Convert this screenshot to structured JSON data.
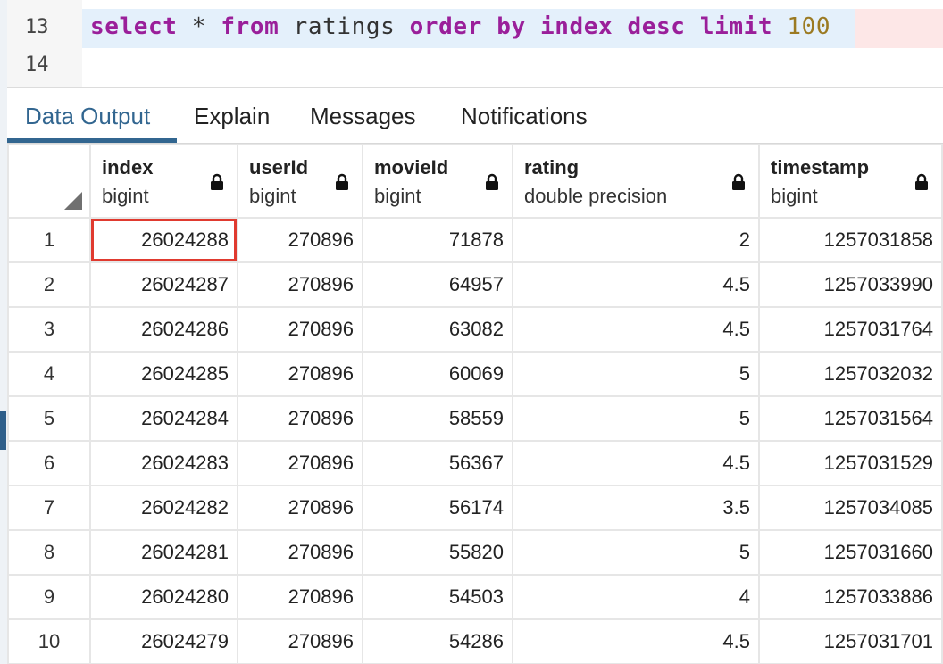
{
  "editor": {
    "lines": [
      {
        "number": "13",
        "tokens": {
          "k1": "select",
          "op": "*",
          "k2": "from",
          "t1": "ratings",
          "k3": "order",
          "k4": "by",
          "k5": "index",
          "k6": "desc",
          "k7": "limit",
          "n1": "100"
        }
      },
      {
        "number": "14"
      }
    ]
  },
  "tabs": [
    {
      "label": "Data Output",
      "active": true
    },
    {
      "label": "Explain"
    },
    {
      "label": "Messages"
    },
    {
      "label": "Notifications"
    }
  ],
  "grid": {
    "columns": [
      {
        "name": "index",
        "type": "bigint"
      },
      {
        "name": "userId",
        "type": "bigint"
      },
      {
        "name": "movieId",
        "type": "bigint"
      },
      {
        "name": "rating",
        "type": "double precision"
      },
      {
        "name": "timestamp",
        "type": "bigint"
      }
    ],
    "rows": [
      [
        "1",
        "26024288",
        "270896",
        "71878",
        "2",
        "1257031858"
      ],
      [
        "2",
        "26024287",
        "270896",
        "64957",
        "4.5",
        "1257033990"
      ],
      [
        "3",
        "26024286",
        "270896",
        "63082",
        "4.5",
        "1257031764"
      ],
      [
        "4",
        "26024285",
        "270896",
        "60069",
        "5",
        "1257032032"
      ],
      [
        "5",
        "26024284",
        "270896",
        "58559",
        "5",
        "1257031564"
      ],
      [
        "6",
        "26024283",
        "270896",
        "56367",
        "4.5",
        "1257031529"
      ],
      [
        "7",
        "26024282",
        "270896",
        "56174",
        "3.5",
        "1257034085"
      ],
      [
        "8",
        "26024281",
        "270896",
        "55820",
        "5",
        "1257031660"
      ],
      [
        "9",
        "26024280",
        "270896",
        "54503",
        "4",
        "1257033886"
      ],
      [
        "10",
        "26024279",
        "270896",
        "54286",
        "4.5",
        "1257031701"
      ]
    ]
  },
  "colors": {
    "accent": "#326690",
    "highlight": "#e03a2f",
    "keyword": "#9a1f9a",
    "number": "#9b7a22"
  },
  "icons": {
    "column_lock": "lock-icon",
    "corner": "select-all-icon"
  }
}
